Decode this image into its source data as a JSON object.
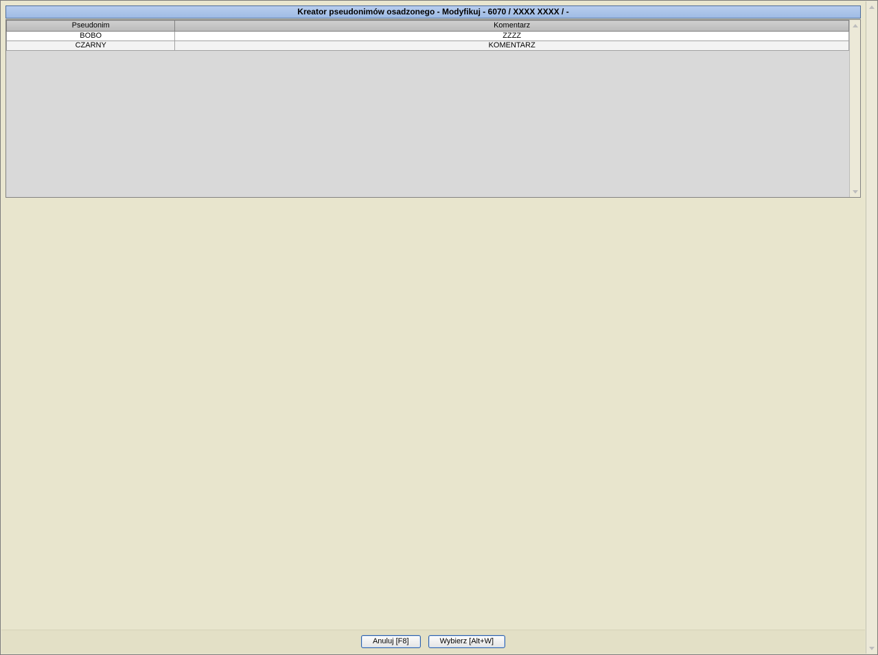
{
  "window": {
    "title": "Kreator pseudonimów osadzonego - Modyfikuj - 6070 / XXXX XXXX / -"
  },
  "grid": {
    "columns": {
      "pseudonym": "Pseudonim",
      "comment": "Komentarz"
    },
    "rows": [
      {
        "pseudonym": "BOBO",
        "comment": "ZZZZ"
      },
      {
        "pseudonym": "CZARNY",
        "comment": "KOMENTARZ"
      }
    ]
  },
  "buttons": {
    "cancel": "Anuluj [F8]",
    "select": "Wybierz [Alt+W]"
  }
}
